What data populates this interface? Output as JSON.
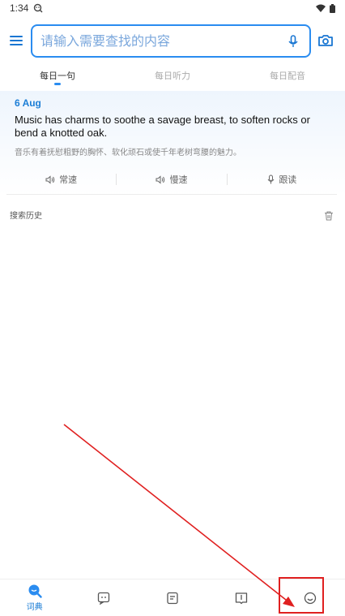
{
  "status_bar": {
    "time": "1:34"
  },
  "search": {
    "placeholder": "请输入需要查找的内容",
    "value": ""
  },
  "tabs": [
    {
      "label": "每日一句",
      "active": true
    },
    {
      "label": "每日听力",
      "active": false
    },
    {
      "label": "每日配音",
      "active": false
    }
  ],
  "daily": {
    "date": "6 Aug",
    "sentence_en": "Music has charms to soothe a savage breast, to soften rocks or bend a knotted oak.",
    "sentence_zh": "音乐有着抚慰粗野的胸怀、软化顽石或使千年老树弯腰的魅力。",
    "actions": {
      "normal_speed": "常速",
      "slow_speed": "慢速",
      "follow_read": "跟读"
    }
  },
  "history": {
    "title": "搜索历史"
  },
  "bottom_nav": {
    "items": [
      {
        "label": "词典",
        "icon": "dictionary-search-icon",
        "active": true
      },
      {
        "label": "",
        "icon": "chat-icon",
        "active": false
      },
      {
        "label": "",
        "icon": "notes-icon",
        "active": false
      },
      {
        "label": "",
        "icon": "book-icon",
        "active": false
      },
      {
        "label": "",
        "icon": "smiley-icon",
        "active": false
      }
    ]
  },
  "colors": {
    "accent": "#2a8cf0",
    "annotation": "#e02020"
  }
}
